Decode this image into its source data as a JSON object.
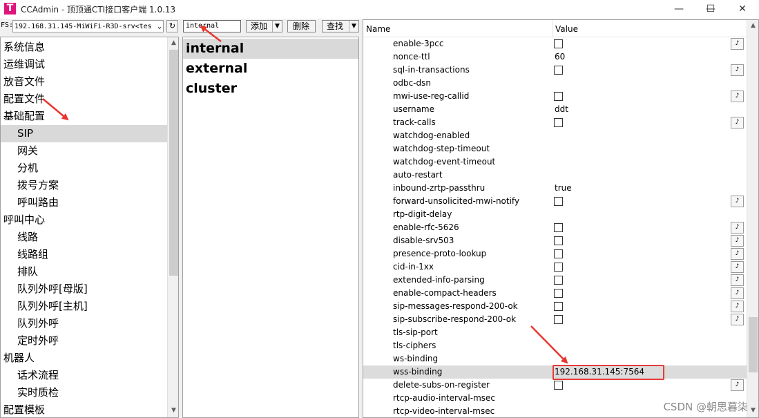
{
  "window": {
    "title": "CCAdmin - 顶顶通CTI接口客户端 1.0.13",
    "logo_letter": "T",
    "minimize": "—",
    "maximize": "☐",
    "close": "✕"
  },
  "toolbar": {
    "fs_label": "FS:",
    "fs_server_selected": "192.168.31.145-MiWiFi-R3D-srv<tes",
    "refresh_icon": "↻",
    "profile_input_value": "internal",
    "add_label": "添加",
    "delete_label": "删除",
    "search_label": "查找"
  },
  "tree": {
    "items": [
      {
        "label": "系统信息",
        "level": 0
      },
      {
        "label": "运维调试",
        "level": 0
      },
      {
        "label": "放音文件",
        "level": 0
      },
      {
        "label": "配置文件",
        "level": 0
      },
      {
        "label": "基础配置",
        "level": 0
      },
      {
        "label": "SIP",
        "level": 1,
        "selected": true
      },
      {
        "label": "网关",
        "level": 1
      },
      {
        "label": "分机",
        "level": 1
      },
      {
        "label": "拨号方案",
        "level": 1
      },
      {
        "label": "呼叫路由",
        "level": 1
      },
      {
        "label": "呼叫中心",
        "level": 0
      },
      {
        "label": "线路",
        "level": 1
      },
      {
        "label": "线路组",
        "level": 1
      },
      {
        "label": "排队",
        "level": 1
      },
      {
        "label": "队列外呼[母版]",
        "level": 1
      },
      {
        "label": "队列外呼[主机]",
        "level": 1
      },
      {
        "label": "队列外呼",
        "level": 1
      },
      {
        "label": "定时外呼",
        "level": 1
      },
      {
        "label": "机器人",
        "level": 0
      },
      {
        "label": "话术流程",
        "level": 1
      },
      {
        "label": "实时质检",
        "level": 1
      },
      {
        "label": "配置模板",
        "level": 0
      }
    ]
  },
  "profiles": {
    "items": [
      {
        "label": "internal",
        "selected": true
      },
      {
        "label": "external"
      },
      {
        "label": "cluster"
      }
    ]
  },
  "grid": {
    "name_header": "Name",
    "value_header": "Value",
    "edit_button_icon": "♪",
    "rows": [
      {
        "name": "enable-3pcc",
        "type": "check",
        "button": true
      },
      {
        "name": "nonce-ttl",
        "type": "text",
        "value": "60"
      },
      {
        "name": "sql-in-transactions",
        "type": "check",
        "button": true
      },
      {
        "name": "odbc-dsn",
        "type": "text",
        "value": ""
      },
      {
        "name": "mwi-use-reg-callid",
        "type": "check",
        "button": true
      },
      {
        "name": "username",
        "type": "text",
        "value": "ddt"
      },
      {
        "name": "track-calls",
        "type": "check",
        "button": true
      },
      {
        "name": "watchdog-enabled",
        "type": "text",
        "value": ""
      },
      {
        "name": "watchdog-step-timeout",
        "type": "text",
        "value": ""
      },
      {
        "name": "watchdog-event-timeout",
        "type": "text",
        "value": ""
      },
      {
        "name": "auto-restart",
        "type": "text",
        "value": ""
      },
      {
        "name": "inbound-zrtp-passthru",
        "type": "text",
        "value": "true"
      },
      {
        "name": "forward-unsolicited-mwi-notify",
        "type": "check",
        "button": true
      },
      {
        "name": "rtp-digit-delay",
        "type": "text",
        "value": ""
      },
      {
        "name": "enable-rfc-5626",
        "type": "check",
        "button": true
      },
      {
        "name": "disable-srv503",
        "type": "check",
        "button": true
      },
      {
        "name": "presence-proto-lookup",
        "type": "check",
        "button": true
      },
      {
        "name": "cid-in-1xx",
        "type": "check",
        "button": true
      },
      {
        "name": "extended-info-parsing",
        "type": "check",
        "button": true
      },
      {
        "name": "enable-compact-headers",
        "type": "check",
        "button": true
      },
      {
        "name": "sip-messages-respond-200-ok",
        "type": "check",
        "button": true
      },
      {
        "name": "sip-subscribe-respond-200-ok",
        "type": "check",
        "button": true
      },
      {
        "name": "tls-sip-port",
        "type": "text",
        "value": ""
      },
      {
        "name": "tls-ciphers",
        "type": "text",
        "value": ""
      },
      {
        "name": "ws-binding",
        "type": "text",
        "value": ""
      },
      {
        "name": "wss-binding",
        "type": "text",
        "value": "192.168.31.145:7564",
        "selected": true
      },
      {
        "name": "delete-subs-on-register",
        "type": "check",
        "button": true
      },
      {
        "name": "rtcp-audio-interval-msec",
        "type": "text",
        "value": ""
      },
      {
        "name": "rtcp-video-interval-msec",
        "type": "text",
        "value": ""
      }
    ]
  },
  "watermark": "CSDN @朝思暮柒",
  "colors": {
    "annotation": "#e8352e",
    "selection": "#d9d9d9",
    "logo": "#e0157a"
  }
}
